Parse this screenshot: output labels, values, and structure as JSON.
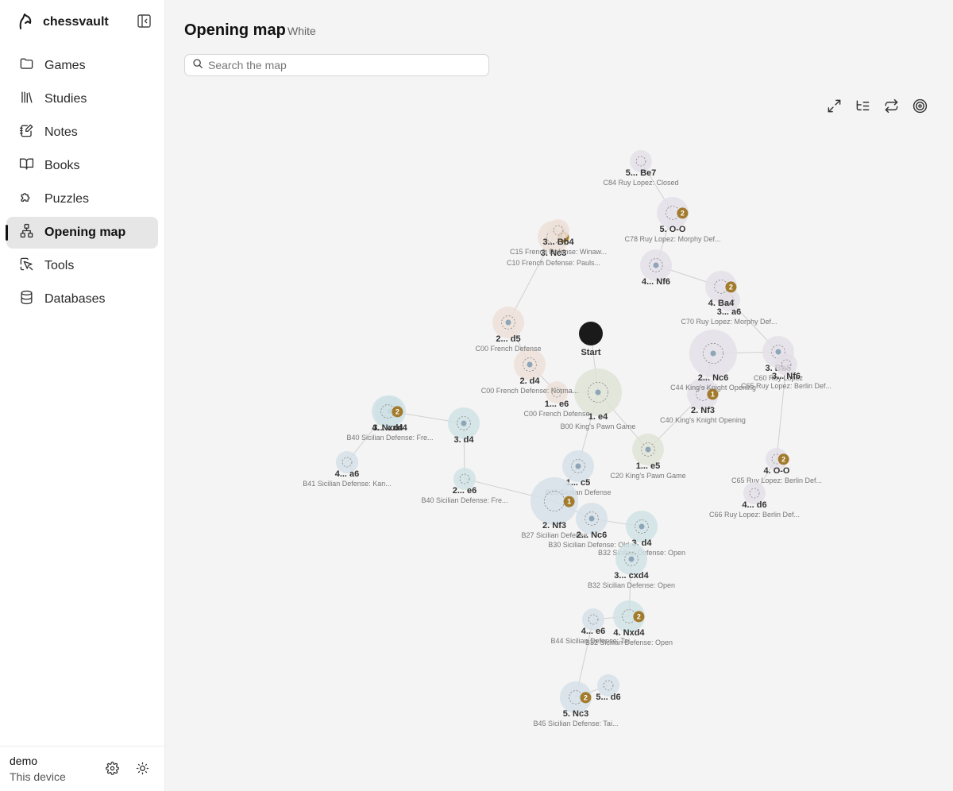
{
  "app": {
    "name": "chessvault"
  },
  "sidebar": {
    "items": [
      {
        "label": "Games",
        "icon": "folder-icon",
        "name": "sidebar-item-games",
        "active": false
      },
      {
        "label": "Studies",
        "icon": "library-icon",
        "name": "sidebar-item-studies",
        "active": false
      },
      {
        "label": "Notes",
        "icon": "notebook-pen-icon",
        "name": "sidebar-item-notes",
        "active": false
      },
      {
        "label": "Books",
        "icon": "book-open-icon",
        "name": "sidebar-item-books",
        "active": false
      },
      {
        "label": "Puzzles",
        "icon": "puzzle-icon",
        "name": "sidebar-item-puzzles",
        "active": false
      },
      {
        "label": "Opening map",
        "icon": "network-icon",
        "name": "sidebar-item-opening-map",
        "active": true
      },
      {
        "label": "Tools",
        "icon": "mouse-pointer-icon",
        "name": "sidebar-item-tools",
        "active": false
      },
      {
        "label": "Databases",
        "icon": "database-icon",
        "name": "sidebar-item-databases",
        "active": false
      }
    ]
  },
  "user": {
    "name": "demo",
    "device": "This device"
  },
  "header": {
    "title": "Opening map",
    "subtitle": "White"
  },
  "search": {
    "placeholder": "Search the map",
    "value": ""
  },
  "toolbar": [
    "expand-icon",
    "list-tree-icon",
    "repeat-icon",
    "target-icon"
  ],
  "colors": {
    "badge": "#a27b2c",
    "green": "#dfe3d6",
    "teal": "#cfe2e5",
    "blue": "#d5e0e8",
    "purple": "#e4dfe8",
    "peach": "#ece0d8",
    "start": "#1a1a1a",
    "edge": "#d0d0d0",
    "dot": "#8ea5b8"
  },
  "map": {
    "nodes": [
      {
        "id": "start",
        "move": "Start",
        "eco": "",
        "type": "start"
      },
      {
        "id": "e4",
        "move": "1. e4",
        "eco": "B00 King's Pawn Game",
        "color": "green",
        "weight": 3
      },
      {
        "id": "e6",
        "move": "1... e6",
        "eco": "C00 French Defense",
        "color": "peach",
        "weight": 1
      },
      {
        "id": "fr_d4",
        "move": "2. d4",
        "eco": "C00 French Defense: Norma...",
        "color": "peach",
        "weight": 2
      },
      {
        "id": "fr_d5",
        "move": "2... d5",
        "eco": "C00 French Defense",
        "color": "peach",
        "weight": 2
      },
      {
        "id": "nc3",
        "move": "3. Nc3",
        "eco": "C10 French Defense: Pauls...",
        "color": "peach",
        "weight": 2,
        "badge": "2"
      },
      {
        "id": "bb4",
        "move": "3... Bb4",
        "eco": "C15 French Defense: Winaw...",
        "color": "peach",
        "weight": 1
      },
      {
        "id": "e5",
        "move": "1... e5",
        "eco": "C20 King's Pawn Game",
        "color": "green",
        "weight": 2
      },
      {
        "id": "nf3",
        "move": "2. Nf3",
        "eco": "C40 King's Knight Opening",
        "color": "purple",
        "weight": 2,
        "badge": "1"
      },
      {
        "id": "nc6",
        "move": "2... Nc6",
        "eco": "C44 King's Knight Opening",
        "color": "purple",
        "weight": 3
      },
      {
        "id": "bb5",
        "move": "3. Bb5",
        "eco": "C60 Ruy Lopez",
        "color": "purple",
        "weight": 2
      },
      {
        "id": "a6",
        "move": "3... a6",
        "eco": "C70 Ruy Lopez: Morphy Def...",
        "color": "purple",
        "weight": 1
      },
      {
        "id": "ba4",
        "move": "4. Ba4",
        "eco": "",
        "color": "purple",
        "weight": 2,
        "badge": "2"
      },
      {
        "id": "nf6_4",
        "move": "4... Nf6",
        "eco": "",
        "color": "purple",
        "weight": 2
      },
      {
        "id": "oo5",
        "move": "5. O-O",
        "eco": "C78 Ruy Lopez: Morphy Def...",
        "color": "purple",
        "weight": 2,
        "badge": "2"
      },
      {
        "id": "be7",
        "move": "5... Be7",
        "eco": "C84 Ruy Lopez: Closed",
        "color": "purple",
        "weight": 1
      },
      {
        "id": "nf6_3",
        "move": "3... Nf6",
        "eco": "C65 Ruy Lopez: Berlin Def...",
        "color": "purple",
        "weight": 1
      },
      {
        "id": "oo4",
        "move": "4. O-O",
        "eco": "C65 Ruy Lopez: Berlin Def...",
        "color": "purple",
        "weight": 1,
        "badge": "2"
      },
      {
        "id": "d6_4",
        "move": "4... d6",
        "eco": "C66 Ruy Lopez: Berlin Def...",
        "color": "purple",
        "weight": 1
      },
      {
        "id": "c5",
        "move": "1... c5",
        "eco": "B20 Sicilian Defense",
        "color": "blue",
        "weight": 2
      },
      {
        "id": "nf3s",
        "move": "2. Nf3",
        "eco": "B27 Sicilian Defense",
        "color": "blue",
        "weight": 3,
        "badge": "1"
      },
      {
        "id": "nc6s",
        "move": "2... Nc6",
        "eco": "B30 Sicilian Defense: Old...",
        "color": "blue",
        "weight": 2
      },
      {
        "id": "d4s",
        "move": "3. d4",
        "eco": "B32 Sicilian Defense: Open",
        "color": "teal",
        "weight": 2
      },
      {
        "id": "cxd4",
        "move": "3... cxd4",
        "eco": "B32 Sicilian Defense: Open",
        "color": "teal",
        "weight": 2
      },
      {
        "id": "nxd4",
        "move": "4. Nxd4",
        "eco": "B32 Sicilian Defense: Open",
        "color": "teal",
        "weight": 2,
        "badge": "2"
      },
      {
        "id": "e6_4",
        "move": "4... e6",
        "eco": "B44 Sicilian Defense: Tai...",
        "color": "blue",
        "weight": 1
      },
      {
        "id": "nc3_5",
        "move": "5. Nc3",
        "eco": "B45 Sicilian Defense: Tai...",
        "color": "blue",
        "weight": 2,
        "badge": "2"
      },
      {
        "id": "d6_5",
        "move": "5... d6",
        "eco": "",
        "color": "blue",
        "weight": 1
      },
      {
        "id": "e6s",
        "move": "2... e6",
        "eco": "B40 Sicilian Defense: Fre...",
        "color": "teal",
        "weight": 1
      },
      {
        "id": "d4_3",
        "move": "3. d4",
        "eco": "",
        "color": "teal",
        "weight": 2
      },
      {
        "id": "cxd4_3",
        "move": "3... cxd4",
        "eco": "B40 Sicilian Defense: Fre...",
        "color": "teal",
        "weight": 2
      },
      {
        "id": "nxd4_4",
        "move": "4. Nxd4",
        "eco": "",
        "color": "teal",
        "weight": 2,
        "badge": "2"
      },
      {
        "id": "a6_4",
        "move": "4... a6",
        "eco": "B41 Sicilian Defense: Kan...",
        "color": "blue",
        "weight": 1
      }
    ],
    "edges": [
      [
        "start",
        "e4"
      ],
      [
        "e4",
        "e6"
      ],
      [
        "e6",
        "fr_d4"
      ],
      [
        "fr_d4",
        "fr_d5"
      ],
      [
        "fr_d5",
        "nc3"
      ],
      [
        "nc3",
        "bb4"
      ],
      [
        "e4",
        "e5"
      ],
      [
        "e5",
        "nf3"
      ],
      [
        "nf3",
        "nc6"
      ],
      [
        "nc6",
        "bb5"
      ],
      [
        "bb5",
        "a6"
      ],
      [
        "a6",
        "ba4"
      ],
      [
        "ba4",
        "nf6_4"
      ],
      [
        "nf6_4",
        "oo5"
      ],
      [
        "oo5",
        "be7"
      ],
      [
        "bb5",
        "nf6_3"
      ],
      [
        "nf6_3",
        "oo4"
      ],
      [
        "oo4",
        "d6_4"
      ],
      [
        "e4",
        "c5"
      ],
      [
        "c5",
        "nf3s"
      ],
      [
        "nf3s",
        "nc6s"
      ],
      [
        "nc6s",
        "d4s"
      ],
      [
        "d4s",
        "cxd4"
      ],
      [
        "cxd4",
        "nxd4"
      ],
      [
        "nxd4",
        "e6_4"
      ],
      [
        "e6_4",
        "nc3_5"
      ],
      [
        "nc3_5",
        "d6_5"
      ],
      [
        "nf3s",
        "e6s"
      ],
      [
        "e6s",
        "d4_3"
      ],
      [
        "d4_3",
        "cxd4_3"
      ],
      [
        "cxd4_3",
        "nxd4_4"
      ],
      [
        "nxd4_4",
        "a6_4"
      ]
    ]
  }
}
